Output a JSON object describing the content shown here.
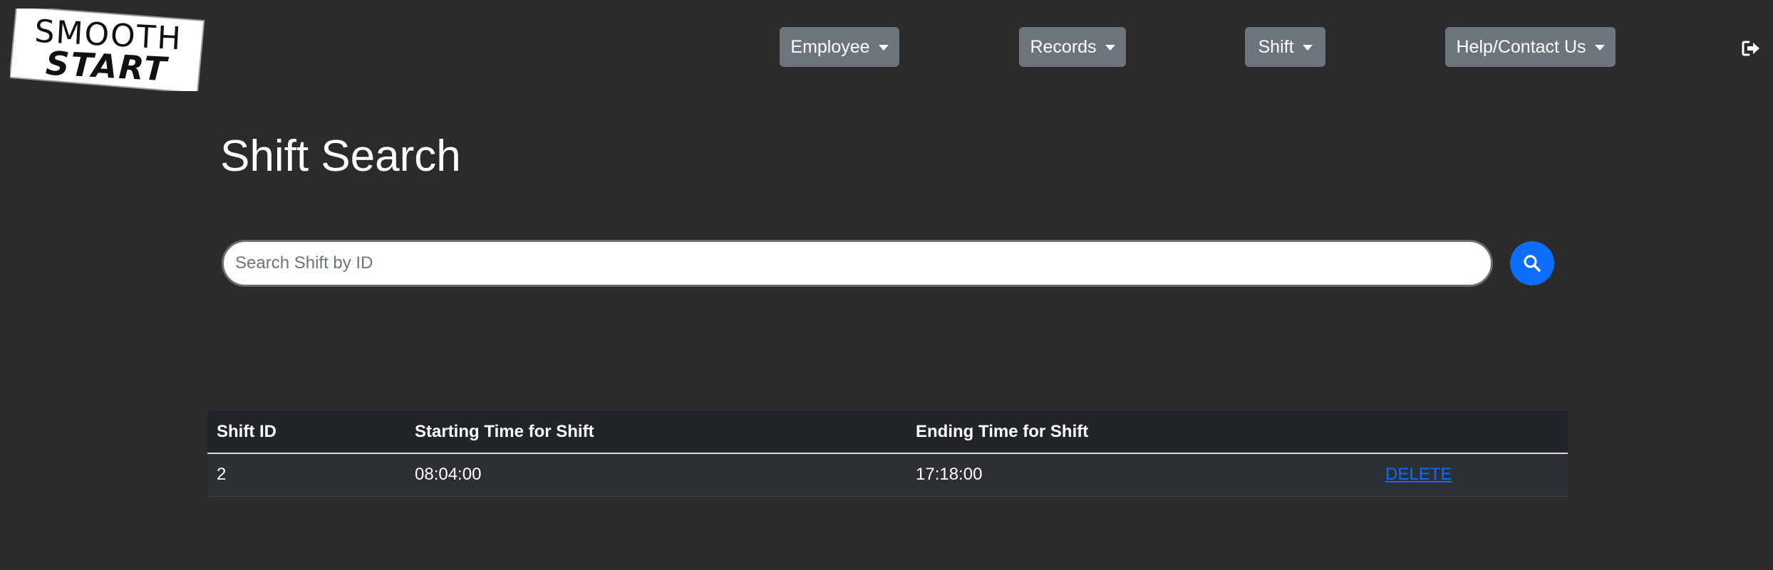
{
  "logo": {
    "line1": "SMOOTH",
    "line2": "START"
  },
  "nav": {
    "items": [
      {
        "label": "Employee",
        "icon": "caret-down-icon"
      },
      {
        "label": "Records",
        "icon": "caret-down-icon"
      },
      {
        "label": "Shift",
        "icon": "caret-down-icon"
      },
      {
        "label": "Help/Contact Us",
        "icon": "caret-down-icon"
      }
    ],
    "logout_icon": "logout-icon"
  },
  "page": {
    "title": "Shift Search"
  },
  "search": {
    "placeholder": "Search Shift by ID",
    "value": "",
    "button_icon": "search-icon"
  },
  "table": {
    "headers": [
      "Shift ID",
      "Starting Time for Shift",
      "Ending Time for Shift",
      ""
    ],
    "rows": [
      {
        "id": "2",
        "start": "08:04:00",
        "end": "17:18:00",
        "action": "DELETE"
      }
    ]
  },
  "colors": {
    "background": "#2b2b2b",
    "nav_button": "#6c757d",
    "accent": "#0d6efd",
    "table_header": "#212529",
    "table_row": "#2c3034"
  }
}
